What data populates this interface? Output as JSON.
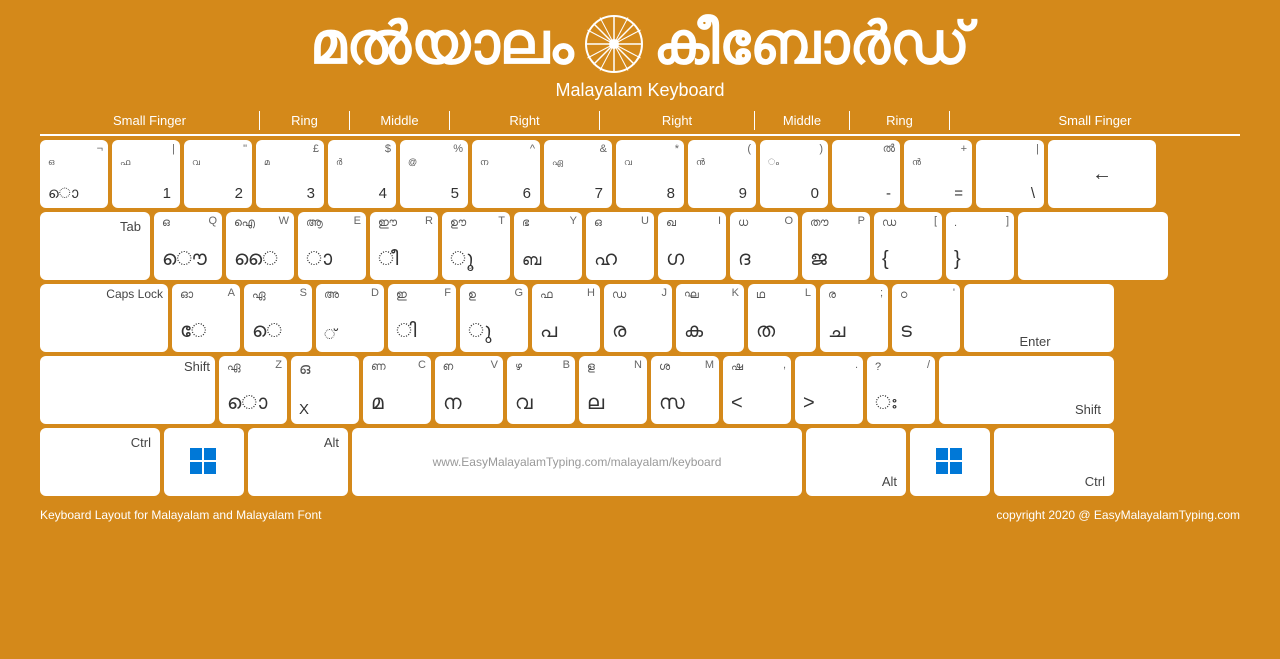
{
  "header": {
    "title_left": "മല്‍യാലം",
    "title_right": "കീബോർഡ്",
    "subtitle": "Malayalam Keyboard"
  },
  "finger_labels": {
    "small_finger_left": "Small Finger",
    "ring_left": "Ring",
    "middle_left": "Middle",
    "right_left": "Right",
    "right_right": "Right",
    "middle_right": "Middle",
    "ring_right": "Ring",
    "small_finger_right": "Small Finger"
  },
  "keyboard": {
    "space_url": "www.EasyMalayalamTyping.com/malayalam/keyboard"
  },
  "footer": {
    "left": "Keyboard Layout for Malayalam and Malayalam Font",
    "right": "copyright 2020 @ EasyMalayalamTyping.com"
  }
}
